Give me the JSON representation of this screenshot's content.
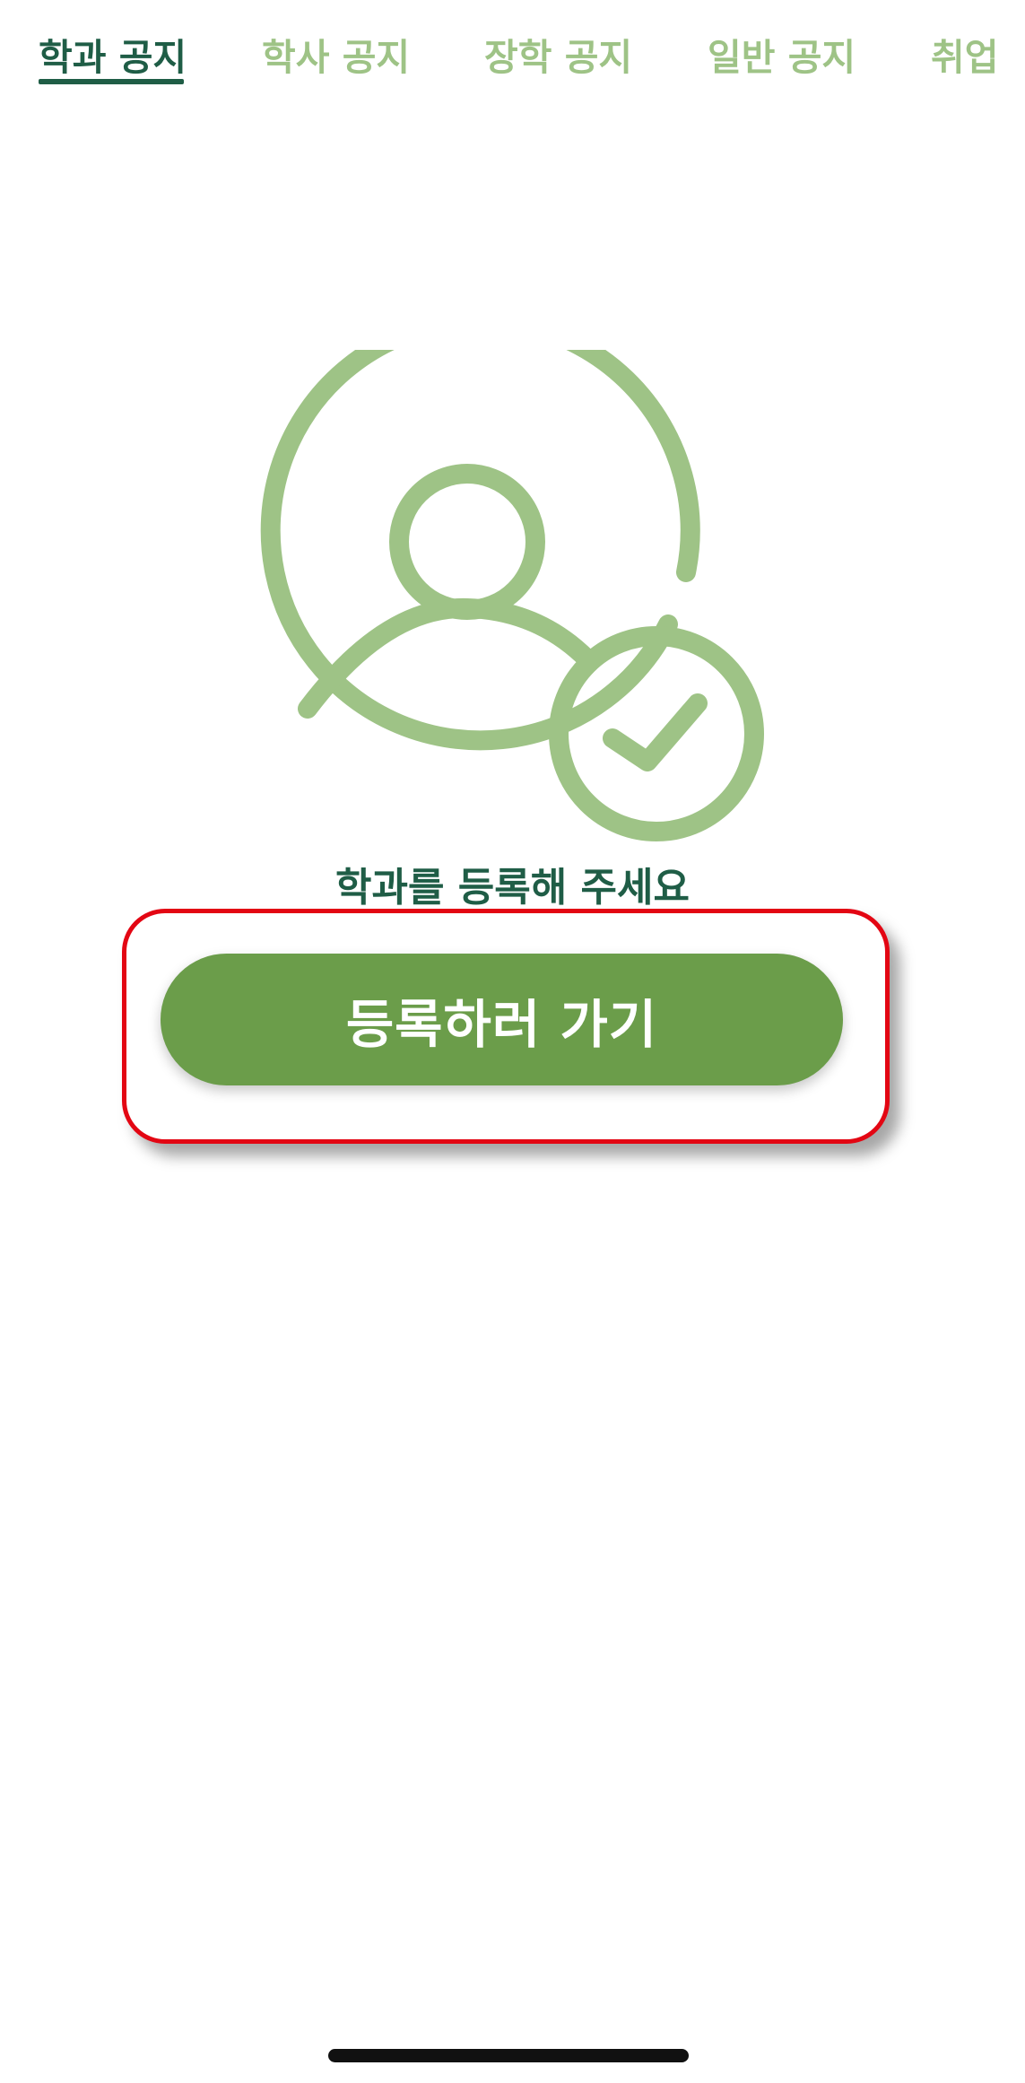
{
  "tabs": [
    {
      "label": "학과 공지",
      "active": true
    },
    {
      "label": "학사 공지",
      "active": false
    },
    {
      "label": "장학 공지",
      "active": false
    },
    {
      "label": "일반 공지",
      "active": false
    },
    {
      "label": "취업",
      "active": false
    }
  ],
  "empty_state": {
    "icon": "user-check-icon",
    "message": "학과를 등록해 주세요",
    "button_label": "등록하러 가기"
  },
  "colors": {
    "primary_dark": "#1f5d46",
    "tab_inactive": "#9ec386",
    "illustration": "#9ec386",
    "button": "#6b9d4a",
    "highlight": "#e30613"
  }
}
